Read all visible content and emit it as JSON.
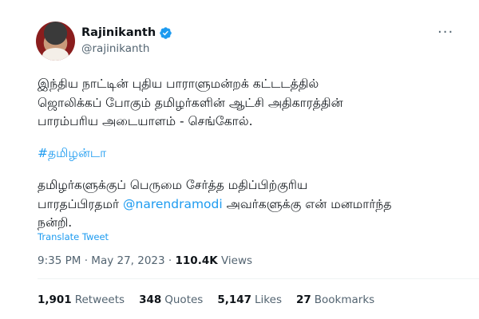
{
  "author": {
    "name": "Rajinikanth",
    "handle": "@rajinikanth",
    "verified_color": "#1d9bf0"
  },
  "tweet": {
    "para1_lines": [
      "இந்திய நாட்டின் புதிய பாராளுமன்றக் கட்டடத்தில்",
      "ஜொலிக்கப் போகும் தமிழர்களின் ஆட்சி அதிகாரத்தின்",
      "பாரம்பரிய அடையாளம் - செங்கோல்."
    ],
    "hashtag": "#தமிழன்டா",
    "para2_line1": "தமிழர்களுக்குப் பெருமை சேர்த்த மதிப்பிற்குரிய",
    "para2_line2_pre": "பாரதப்பிரதமர் ",
    "mention": "@narendramodi",
    "para2_line2_post": " அவர்களுக்கு என் மனமார்ந்த",
    "para2_line3": "நன்றி."
  },
  "translate_label": "Translate Tweet",
  "meta": {
    "time": "9:35 PM",
    "separator": "·",
    "date": "May 27, 2023",
    "views_count": "110.4K",
    "views_label": "Views"
  },
  "stats": {
    "retweets_count": "1,901",
    "retweets_label": "Retweets",
    "quotes_count": "348",
    "quotes_label": "Quotes",
    "likes_count": "5,147",
    "likes_label": "Likes",
    "bookmarks_count": "27",
    "bookmarks_label": "Bookmarks"
  },
  "colors": {
    "link": "#1d9bf0",
    "muted": "#536471",
    "text": "#0f1419"
  },
  "icons": {
    "more": "more-options-icon",
    "verified": "verified-badge-icon"
  }
}
